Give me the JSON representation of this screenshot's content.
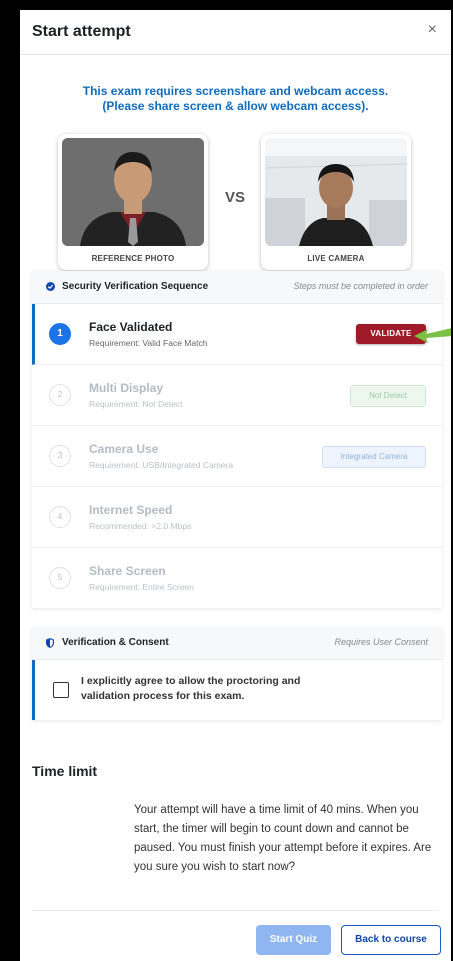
{
  "modal": {
    "title": "Start attempt",
    "close_glyph": "×"
  },
  "notice": {
    "line1": "This exam requires screenshare and webcam access.",
    "line2": "(Please share screen & allow webcam access)."
  },
  "photos": {
    "reference_label": "REFERENCE PHOTO",
    "vs": "VS",
    "live_label": "LIVE CAMERA"
  },
  "security": {
    "icon": "check-circle-icon",
    "title": "Security Verification Sequence",
    "note": "Steps must be completed in order",
    "steps": [
      {
        "num": "1",
        "name": "Face Validated",
        "req": "Requirement: Valid Face Match",
        "action": "VALIDATE"
      },
      {
        "num": "2",
        "name": "Multi Display",
        "req": "Requirement: Not Detect",
        "status": "Not Detect"
      },
      {
        "num": "3",
        "name": "Camera Use",
        "req": "Requirement: USB/Integrated Camera",
        "status": "Integrated Camera"
      },
      {
        "num": "4",
        "name": "Internet Speed",
        "req": "Recommended: >2.0 Mbps"
      },
      {
        "num": "5",
        "name": "Share Screen",
        "req": "Requirement: Entire Screen"
      }
    ]
  },
  "consent": {
    "icon": "shield-icon",
    "title": "Verification & Consent",
    "note": "Requires User Consent",
    "text": "I explicitly agree to allow the proctoring and validation process for this exam."
  },
  "time_limit": {
    "title": "Time limit",
    "text": "Your attempt will have a time limit of 40 mins. When you start, the timer will begin to count down and cannot be paused. You must finish your attempt before it expires. Are you sure you wish to start now?"
  },
  "buttons": {
    "start": "Start Quiz",
    "back": "Back to course"
  },
  "colors": {
    "accent": "#0f6cbf",
    "validate": "#a01b2a",
    "arrow": "#7ac143"
  }
}
